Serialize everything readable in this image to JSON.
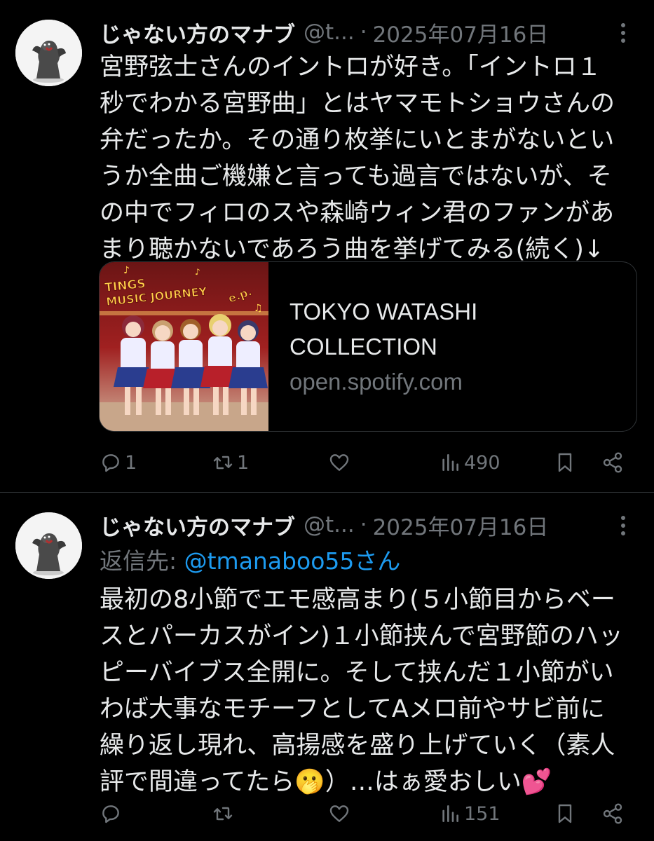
{
  "tweets": [
    {
      "author_name": "じゃない方のマナブ",
      "handle": "@t...",
      "separator": "·",
      "date": "2025年07月16日",
      "text_lines": [
        "宮野弦士さんのイントロが好き。「イントロ１",
        "秒でわかる宮野曲」とはヤマモトショウさんの",
        "弁だったか。その通り枚挙にいとまがないとい",
        "うか全曲ご機嫌と言っても過言ではないが、そ",
        "の中でフィロのスや森崎ウィン君のファンがあ",
        "まり聴かないであろう曲を挙げてみる(続く)↓"
      ],
      "card": {
        "thumb_title_1": "TINGS",
        "thumb_title_2": "MUSIC JOURNEY",
        "thumb_title_3": "e.p.",
        "title": "TOKYO WATASHI COLLECTION",
        "domain": "open.spotify.com"
      },
      "actions": {
        "replies": "1",
        "reposts": "1",
        "likes": "",
        "views": "490"
      }
    },
    {
      "author_name": "じゃない方のマナブ",
      "handle": "@t...",
      "separator": "·",
      "date": "2025年07月16日",
      "reply_prefix": "返信先: ",
      "reply_mention": "@tmanaboo55さん",
      "text_lines": [
        "最初の8小節でエモ感高まり(５小節目からベー",
        "スとパーカスがイン)１小節挟んで宮野節のハッ",
        "ピーバイブス全開に。そして挟んだ１小節がい",
        "わば大事なモチーフとしてAメロ前やサビ前に",
        "繰り返し現れ、高揚感を盛り上げていく（素人",
        "評で間違ってたら🫢）…はぁ愛おしい💕"
      ],
      "actions": {
        "replies": "",
        "reposts": "",
        "likes": "",
        "views": "151"
      }
    }
  ],
  "icons": {
    "more": "more-dots-icon",
    "reply": "reply-icon",
    "repost": "repost-icon",
    "like": "heart-icon",
    "views": "views-icon",
    "bookmark": "bookmark-icon",
    "share": "share-icon"
  },
  "colors": {
    "background": "#000000",
    "text": "#e7e9ea",
    "muted": "#71767b",
    "link": "#1d9bf0",
    "border": "#2f3336"
  }
}
